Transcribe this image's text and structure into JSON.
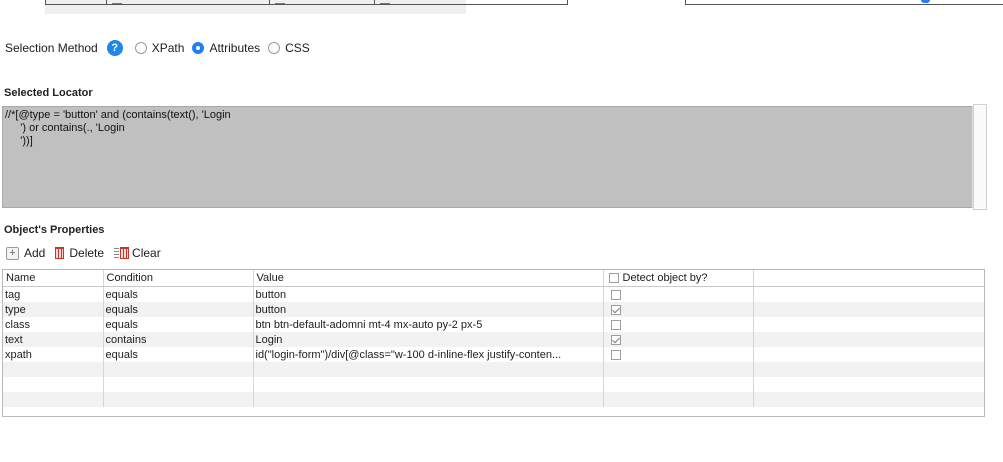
{
  "selection_method": {
    "label": "Selection Method",
    "help_symbol": "?",
    "options": [
      {
        "label": "XPath",
        "selected": false
      },
      {
        "label": "Attributes",
        "selected": true
      },
      {
        "label": "CSS",
        "selected": false
      }
    ],
    "accent_color": "#1f7ef2"
  },
  "selected_locator": {
    "title": "Selected Locator",
    "value": "//*[@type = 'button' and (contains(text(), 'Login\n     ') or contains(., 'Login\n     '))]"
  },
  "object_properties": {
    "title": "Object's Properties",
    "toolbar": {
      "add_label": "Add",
      "delete_label": "Delete",
      "clear_label": "Clear"
    },
    "columns": {
      "name": "Name",
      "condition": "Condition",
      "value": "Value",
      "detect": "Detect object by?"
    },
    "rows": [
      {
        "name": "tag",
        "condition": "equals",
        "value": "button",
        "detect": false
      },
      {
        "name": "type",
        "condition": "equals",
        "value": "button",
        "detect": true
      },
      {
        "name": "class",
        "condition": "equals",
        "value": "btn btn-default-adomni mt-4 mx-auto py-2 px-5",
        "detect": false
      },
      {
        "name": "text",
        "condition": "contains",
        "value": "Login",
        "detect": true
      },
      {
        "name": "xpath",
        "condition": "equals",
        "value": "id(\"login-form\")/div[@class=\"w-100 d-inline-flex justify-conten...",
        "detect": false
      }
    ]
  }
}
